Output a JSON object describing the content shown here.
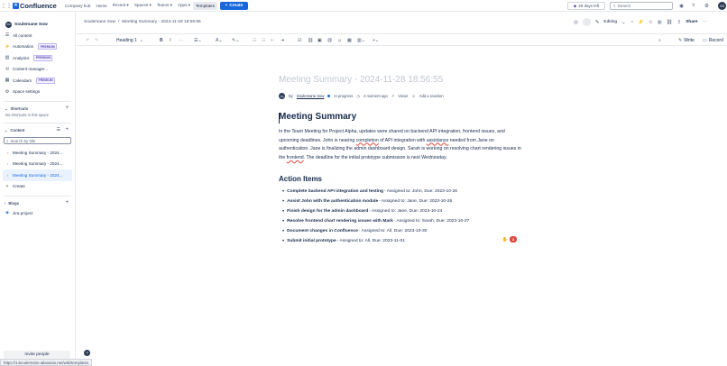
{
  "topbar": {
    "app_name": "Confluence",
    "nav": [
      "Company hub",
      "Home",
      "Recent ▾",
      "Spaces ▾",
      "Teams ▾",
      "Apps ▾",
      "Templates"
    ],
    "create_label": "Create",
    "trial_label": "29 days left",
    "search_placeholder": "Search",
    "avatar_initials": "SS"
  },
  "sidebar": {
    "space_initials": "SS",
    "space_name": "Soulemane Sow",
    "items": [
      {
        "icon": "content-icon",
        "label": "All content",
        "premium": ""
      },
      {
        "icon": "automation-icon",
        "label": "Automation",
        "premium": "PREMIUM"
      },
      {
        "icon": "analytics-icon",
        "label": "Analytics",
        "premium": "PREMIUM"
      },
      {
        "icon": "content-manager-icon",
        "label": "Content manager...",
        "premium": ""
      },
      {
        "icon": "calendar-icon",
        "label": "Calendars",
        "premium": "PREMIUM"
      },
      {
        "icon": "settings-icon",
        "label": "Space settings",
        "premium": ""
      }
    ],
    "shortcuts_label": "Shortcuts",
    "shortcuts_empty": "No shortcuts in this space",
    "content_label": "Content",
    "search_placeholder": "Search by title",
    "tree": [
      "Meeting Summary - 2024...",
      "Meeting Summary - 2024...",
      "Meeting Summary - 2024..."
    ],
    "create_label": "Create",
    "blogs_label": "Blogs",
    "jira_label": "Jira project",
    "invite_label": "Invite people",
    "status_url": "https://14soulemane.atlassian.net/wiki/templates"
  },
  "header": {
    "breadcrumb_space": "Soulemane Sow",
    "breadcrumb_page": "Meeting Summary - 2024-11-28 18:56:55",
    "editing_label": "Editing",
    "share_label": "Share"
  },
  "toolbar": {
    "style_label": "Heading 1",
    "text_color": "A",
    "write_label": "Write",
    "record_label": "Record"
  },
  "page": {
    "title_placeholder": "Meeting Summary - 2024-11-28 18:56:55",
    "byline_prefix": "By",
    "author": "Soulemane Sow",
    "author_initials": "SS",
    "status": "In progress",
    "edited": "4 moment ago",
    "views": "Views",
    "reaction": "Add a reaction",
    "heading": "Meeting Summary",
    "paragraph_1": "In the Team Meeting for Project Alpha, updates were shared on backend API integration, frontend issues, and upcoming deadlines. John is nearing ",
    "paragraph_word_1": "completion",
    "paragraph_2": " of API integration with ",
    "paragraph_word_2": "assistance",
    "paragraph_3": " needed from Jane on authentication. Jane is finalizing the admin dashboard design. Sarah is working on resolving chart rendering issues in the ",
    "paragraph_word_3": "frontend",
    "paragraph_4": ". The deadline for the initial prototype submission is next Wednesday.",
    "action_heading": "Action Items",
    "actions": [
      {
        "task": "Complete backend API integration and testing",
        "detail": " - Assigned to: John, Due: 2023-10-26"
      },
      {
        "task": "Assist John with the authentication module",
        "detail": " - Assigned to: Jane, Due: 2023-10-26"
      },
      {
        "task": "Finish design for the admin dashboard",
        "detail": " - Assigned to: Jane, Due: 2023-10-24"
      },
      {
        "task": "Resolve frontend chart rendering issues with Mark",
        "detail": " - Assigned to: Sarah, Due: 2023-10-27"
      },
      {
        "task": "Document changes in Confluence",
        "detail": " - Assigned to: All, Due: 2023-10-30"
      },
      {
        "task": "Submit initial prototype",
        "detail": " - Assigned to: All, Due: 2023-11-01"
      }
    ],
    "reaction_count": "3"
  },
  "colors": {
    "brand": "#1868db",
    "premium": "#5e4db2",
    "selected_bg": "#e9f2fe",
    "badge": "#e2483d"
  }
}
